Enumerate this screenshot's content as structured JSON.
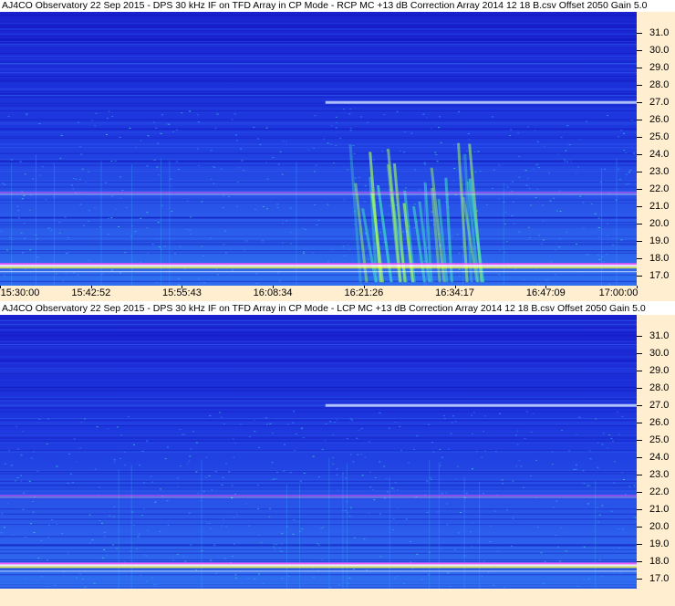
{
  "chart_data": [
    {
      "type": "heatmap",
      "title": "AJ4CO Observatory 22 Sep 2015 - DPS 30 kHz IF on TFD Array in CP Mode - RCP  MC +13 dB  Correction Array 2014 12 18 B.csv  Offset 2050  Gain 5.0",
      "ylabel": "",
      "y_ticks": [
        "31.0",
        "30.0",
        "29.0",
        "28.0",
        "27.0",
        "26.0",
        "25.0",
        "24.0",
        "23.0",
        "22.0",
        "21.0",
        "20.0",
        "19.0",
        "18.0",
        "17.0"
      ],
      "ylim": [
        16.4,
        32.2
      ],
      "x_ticks": [
        "15:30:00",
        "15:42:52",
        "15:55:43",
        "16:08:34",
        "16:21:26",
        "16:34:17",
        "16:47:09",
        "17:00:00"
      ],
      "xlim": [
        "15:30:00",
        "17:00:00"
      ],
      "colormap": [
        "#1a1ad8",
        "#2a60f0",
        "#3aa0ff",
        "#40e0c0",
        "#a0ff60",
        "#ffff40",
        "#ff60ff",
        "#ffffff"
      ],
      "features": [
        {
          "type": "burst",
          "x_start": "16:17:00",
          "x_end": "16:37:00",
          "freq_low": 16.6,
          "freq_high": 24.8
        },
        {
          "type": "interference_line",
          "freq": 27.0,
          "x_start": "16:16:00",
          "x_end": "17:00:00"
        },
        {
          "type": "interference_line",
          "freq": 21.8,
          "x_start": "15:30:00",
          "x_end": "17:00:00"
        },
        {
          "type": "interference_line",
          "freq": 17.6,
          "x_start": "15:30:00",
          "x_end": "17:00:00"
        }
      ]
    },
    {
      "type": "heatmap",
      "title": "AJ4CO Observatory 22 Sep 2015 - DPS 30 kHz IF on TFD Array in CP Mode - LCP  MC +13 dB  Correction Array 2014 12 18 B.csv  Offset 2050  Gain 5.0",
      "ylabel": "",
      "y_ticks": [
        "31.0",
        "30.0",
        "29.0",
        "28.0",
        "27.0",
        "26.0",
        "25.0",
        "24.0",
        "23.0",
        "22.0",
        "21.0",
        "20.0",
        "19.0",
        "18.0",
        "17.0"
      ],
      "ylim": [
        16.4,
        32.2
      ],
      "x_ticks": [],
      "xlim": [
        "15:30:00",
        "17:00:00"
      ],
      "colormap": [
        "#1a1ad8",
        "#2a60f0",
        "#3aa0ff",
        "#40e0c0",
        "#a0ff60",
        "#ffff40",
        "#ff60ff",
        "#ffffff"
      ],
      "features": [
        {
          "type": "interference_line",
          "freq": 27.0,
          "x_start": "16:16:00",
          "x_end": "17:00:00"
        },
        {
          "type": "interference_line",
          "freq": 21.8,
          "x_start": "15:30:00",
          "x_end": "17:00:00"
        },
        {
          "type": "interference_line",
          "freq": 17.8,
          "x_start": "15:30:00",
          "x_end": "17:00:00"
        }
      ]
    }
  ]
}
